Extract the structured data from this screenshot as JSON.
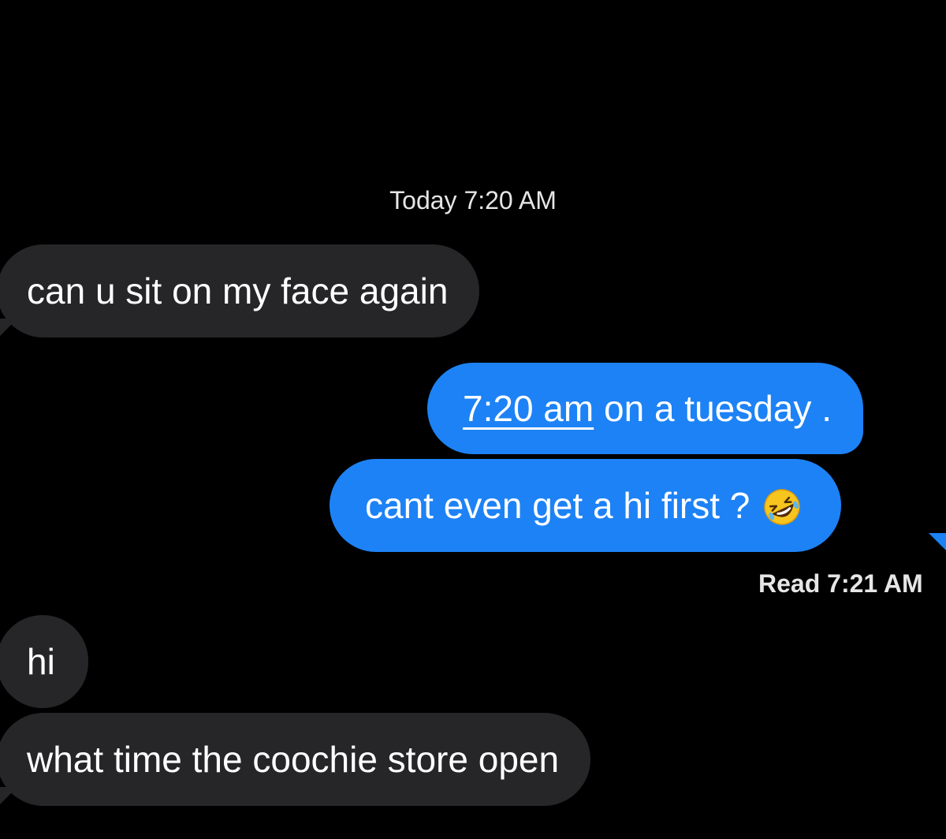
{
  "thread": {
    "timestamp": "Today 7:20 AM",
    "messages": [
      {
        "id": "m1",
        "direction": "incoming",
        "text": "can u sit on my face again"
      },
      {
        "id": "m2",
        "direction": "outgoing",
        "link_text": "7:20 am",
        "text": " on a tuesday ."
      },
      {
        "id": "m3",
        "direction": "outgoing",
        "text": "cant even get a hi first ?",
        "emoji": "rolling-on-the-floor-laughing-emoji"
      },
      {
        "id": "m4",
        "direction": "incoming",
        "text": "hi"
      },
      {
        "id": "m5",
        "direction": "incoming",
        "text": "what time the coochie store open"
      }
    ],
    "read_receipt": {
      "label": "Read",
      "time": "7:21 AM"
    }
  },
  "colors": {
    "background": "#000000",
    "incoming_bubble": "#262628",
    "outgoing_bubble": "#1d82f5",
    "text": "#ffffff",
    "meta_text": "#e6e6e6"
  }
}
